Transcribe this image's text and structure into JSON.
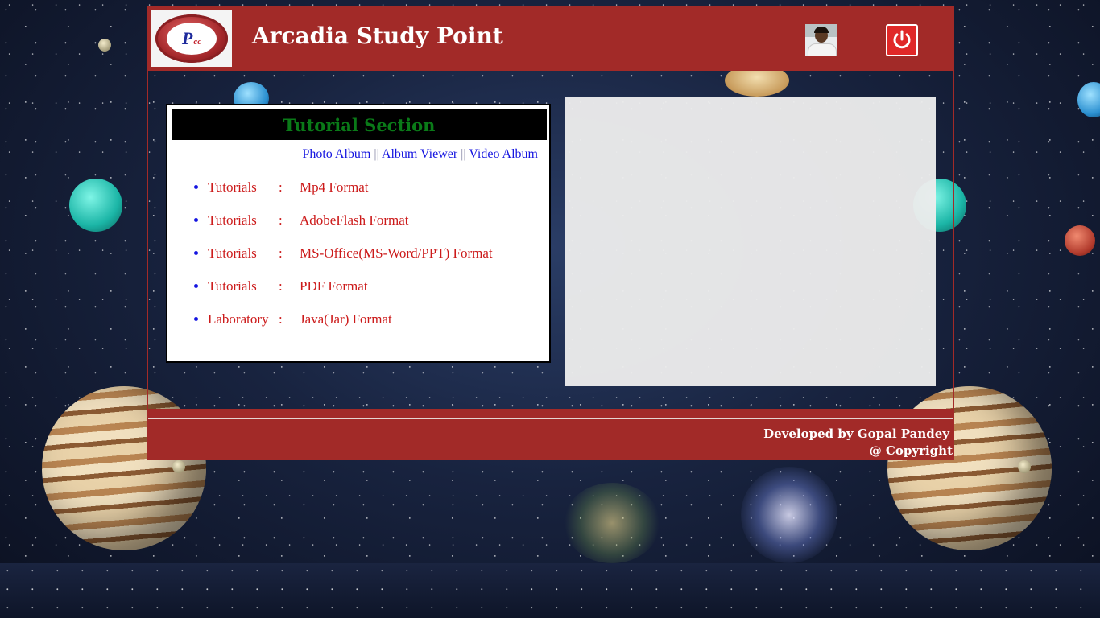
{
  "header": {
    "logo_text": "Pcc",
    "title": "Arcadia Study Point",
    "avatar_icon": "user-avatar-icon",
    "power_icon": "power-icon",
    "accent_color": "#a22a28"
  },
  "tutorial_panel": {
    "heading": "Tutorial Section",
    "album_links": [
      {
        "label": "Photo Album"
      },
      {
        "label": "Album Viewer"
      },
      {
        "label": "Video Album"
      }
    ],
    "separator": "||",
    "items": [
      {
        "label": "Tutorials",
        "colon": ":",
        "format": "Mp4 Format"
      },
      {
        "label": "Tutorials",
        "colon": ":",
        "format": "AdobeFlash Format"
      },
      {
        "label": "Tutorials",
        "colon": ":",
        "format": "MS-Office(MS-Word/PPT) Format"
      },
      {
        "label": "Tutorials",
        "colon": ":",
        "format": "PDF Format"
      },
      {
        "label": "Laboratory",
        "colon": ":",
        "format": "Java(Jar) Format"
      }
    ]
  },
  "footer": {
    "developer": "Developed by Gopal Pandey",
    "copyright": "@ Copyright"
  }
}
